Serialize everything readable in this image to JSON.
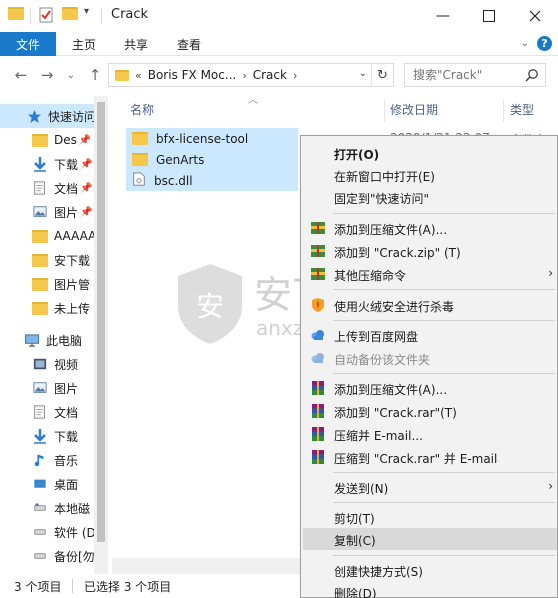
{
  "window": {
    "title": "Crack",
    "minimize_glyph": "—",
    "maximize_glyph": "☐",
    "close_glyph": "✕"
  },
  "ribbon": {
    "file_tab": "文件",
    "tabs": [
      "主页",
      "共享",
      "查看"
    ]
  },
  "address": {
    "overflow": "«",
    "crumbs": [
      "Boris FX Moc...",
      "Crack"
    ],
    "search_placeholder": "搜索\"Crack\""
  },
  "navpane": {
    "items": [
      {
        "label": "快速访问",
        "icon": "star-icon",
        "selected": true,
        "pinned": false
      },
      {
        "label": "Des",
        "icon": "folder-icon",
        "pinned": true
      },
      {
        "label": "下载",
        "icon": "download-icon",
        "pinned": true
      },
      {
        "label": "文档",
        "icon": "document-icon",
        "pinned": true
      },
      {
        "label": "图片",
        "icon": "picture-icon",
        "pinned": true
      },
      {
        "label": "AAAAA",
        "icon": "folder-icon",
        "pinned": false
      },
      {
        "label": "安下载",
        "icon": "folder-icon",
        "pinned": false
      },
      {
        "label": "图片管",
        "icon": "folder-icon",
        "pinned": false
      },
      {
        "label": "未上传",
        "icon": "folder-icon",
        "pinned": false
      },
      {
        "label": "此电脑",
        "icon": "computer-icon",
        "pinned": false
      },
      {
        "label": "视频",
        "icon": "video-icon",
        "pinned": false
      },
      {
        "label": "图片",
        "icon": "picture-icon",
        "pinned": false
      },
      {
        "label": "文档",
        "icon": "document-icon",
        "pinned": false
      },
      {
        "label": "下载",
        "icon": "download-icon",
        "pinned": false
      },
      {
        "label": "音乐",
        "icon": "music-icon",
        "pinned": false
      },
      {
        "label": "桌面",
        "icon": "desktop-icon",
        "pinned": false
      },
      {
        "label": "本地磁",
        "icon": "drive-icon",
        "pinned": false
      },
      {
        "label": "软件 (D",
        "icon": "drive-icon",
        "pinned": false
      },
      {
        "label": "备份[勿",
        "icon": "drive-icon",
        "pinned": false
      }
    ]
  },
  "filelist": {
    "columns": [
      "名称",
      "修改日期",
      "类型"
    ],
    "files": [
      {
        "name": "bfx-license-tool",
        "icon": "folder-icon",
        "date": "2020/1/21 22:07",
        "type": "文件夹"
      },
      {
        "name": "GenArts",
        "icon": "folder-icon"
      },
      {
        "name": "bsc.dll",
        "icon": "dll-file-icon"
      }
    ]
  },
  "watermark": {
    "text": "安下载",
    "domain": "anxz.com"
  },
  "statusbar": {
    "count": "3 个项目",
    "selected": "已选择 3 个项目"
  },
  "context_menu": {
    "items": [
      {
        "label": "打开(O)",
        "bold": true
      },
      {
        "label": "在新窗口中打开(E)"
      },
      {
        "label": "固定到\"快速访问\""
      },
      {
        "label": "添加到压缩文件(A)...",
        "icon": "compress-icon"
      },
      {
        "label": "添加到 \"Crack.zip\" (T)",
        "icon": "compress-icon"
      },
      {
        "label": "其他压缩命令",
        "icon": "compress-icon",
        "submenu": true
      },
      {
        "label": "使用火绒安全进行杀毒",
        "icon": "antivirus-shield-icon"
      },
      {
        "label": "上传到百度网盘",
        "icon": "cloud-upload-icon"
      },
      {
        "label": "自动备份该文件夹",
        "icon": "cloud-backup-icon",
        "disabled": true
      },
      {
        "label": "添加到压缩文件(A)...",
        "icon": "winrar-icon"
      },
      {
        "label": "添加到 \"Crack.rar\"(T)",
        "icon": "winrar-icon"
      },
      {
        "label": "压缩并 E-mail...",
        "icon": "winrar-icon"
      },
      {
        "label": "压缩到 \"Crack.rar\" 并 E-mail",
        "icon": "winrar-icon"
      },
      {
        "label": "发送到(N)",
        "submenu": true
      },
      {
        "label": "剪切(T)"
      },
      {
        "label": "复制(C)",
        "hover": true
      },
      {
        "label": "创建快捷方式(S)"
      },
      {
        "label": "删除(D)"
      }
    ]
  },
  "colors": {
    "accent": "#1979ca",
    "selection": "#cce8ff",
    "menu_bg": "#f2f2f2",
    "menu_hover": "#d9d9d9"
  }
}
